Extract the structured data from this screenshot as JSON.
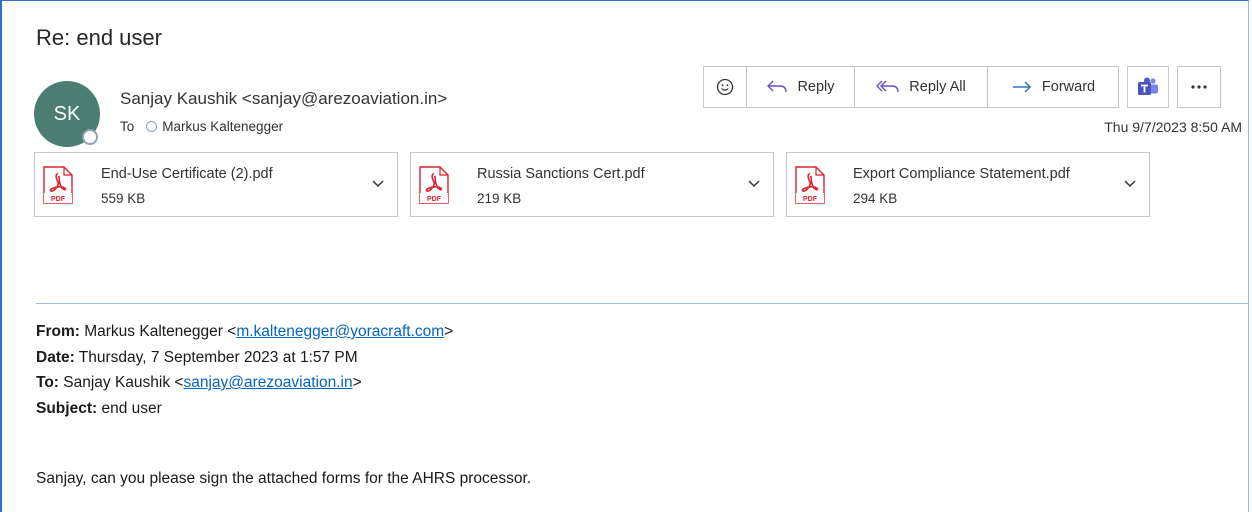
{
  "message": {
    "subject": "Re: end user",
    "sender": {
      "initials": "SK",
      "display": "Sanjay Kaushik <sanjay@arezoaviation.in>"
    },
    "to_label": "To",
    "recipient": "Markus Kaltenegger",
    "date": "Thu 9/7/2023 8:50 AM"
  },
  "actions": {
    "reply": "Reply",
    "reply_all": "Reply All",
    "forward": "Forward"
  },
  "attachments": [
    {
      "name": "End-Use Certificate (2).pdf",
      "size": "559 KB",
      "icon": "pdf-icon"
    },
    {
      "name": "Russia Sanctions Cert.pdf",
      "size": "219 KB",
      "icon": "pdf-icon"
    },
    {
      "name": "Export Compliance Statement.pdf",
      "size": "294 KB",
      "icon": "pdf-icon"
    }
  ],
  "quoted_header": {
    "from_label": "From:",
    "from_name": "Markus Kaltenegger",
    "from_email": "m.kaltenegger@yoracraft.com",
    "date_label": "Date:",
    "date_value": "Thursday, 7 September 2023 at 1:57 PM",
    "to_label": "To:",
    "to_name": "Sanjay Kaushik",
    "to_email": "sanjay@arezoaviation.in",
    "subject_label": "Subject:",
    "subject_value": "end user"
  },
  "body": "Sanjay, can you please sign the attached forms for the AHRS processor.",
  "colors": {
    "accent": "#2f73c4",
    "avatar": "#4c7d73",
    "link": "#0563c1",
    "pdf_red": "#d9232e",
    "teams": "#4b53bc"
  }
}
